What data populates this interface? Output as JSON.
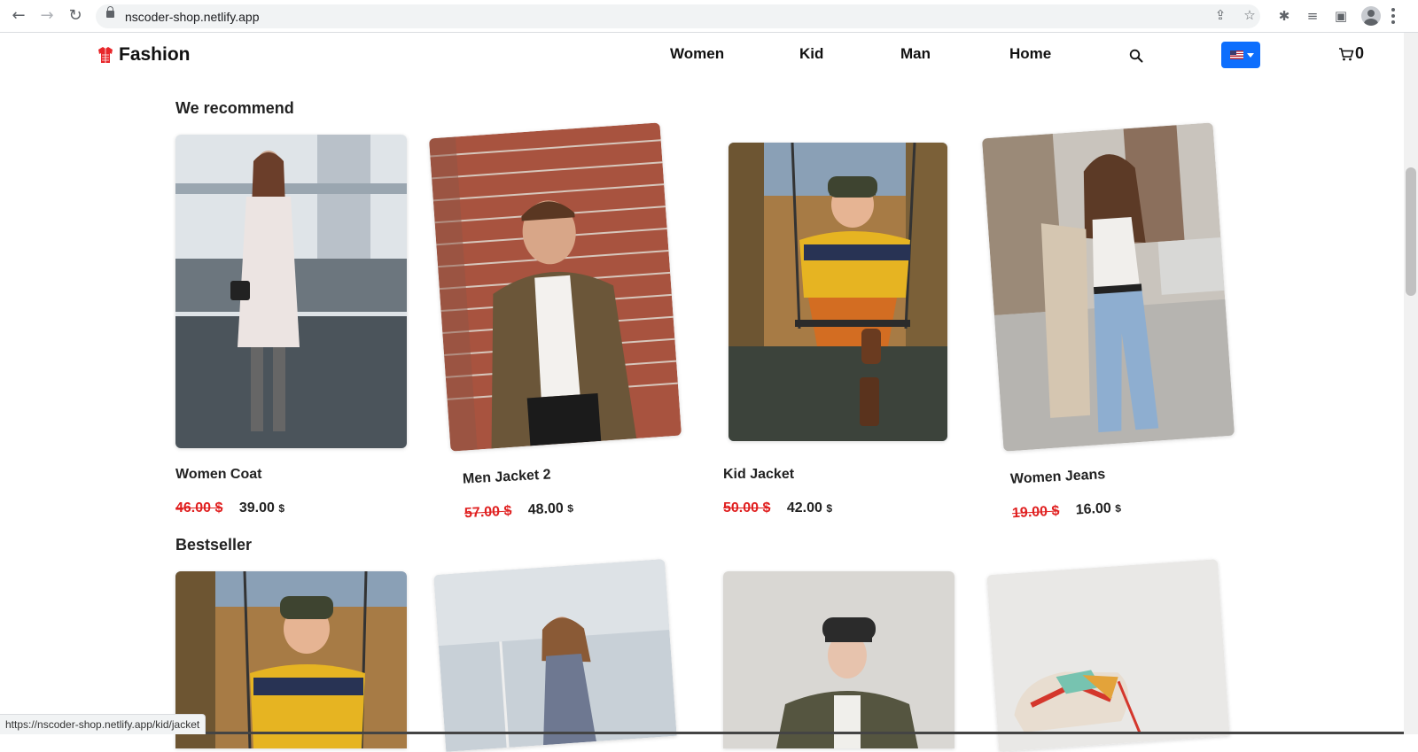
{
  "browser": {
    "url": "nscoder-shop.netlify.app",
    "status_url": "https://nscoder-shop.netlify.app/kid/jacket"
  },
  "header": {
    "brand": "Fashion",
    "nav": [
      "Women",
      "Kid",
      "Man",
      "Home"
    ],
    "cart_count": "0",
    "flag_icon": "us-flag-icon",
    "accent_color": "#0d6efd"
  },
  "recommend": {
    "title": "We recommend",
    "products": [
      {
        "name": "Women Coat",
        "old_price": "46.00 $",
        "price": "39.00",
        "currency": "$"
      },
      {
        "name": "Men Jacket 2",
        "old_price": "57.00 $",
        "price": "48.00",
        "currency": "$"
      },
      {
        "name": "Kid Jacket",
        "old_price": "50.00 $",
        "price": "42.00",
        "currency": "$"
      },
      {
        "name": "Women Jeans",
        "old_price": "19.00 $",
        "price": "16.00",
        "currency": "$"
      }
    ]
  },
  "bestseller": {
    "title": "Bestseller"
  },
  "colors": {
    "old_price": "#e02020"
  }
}
